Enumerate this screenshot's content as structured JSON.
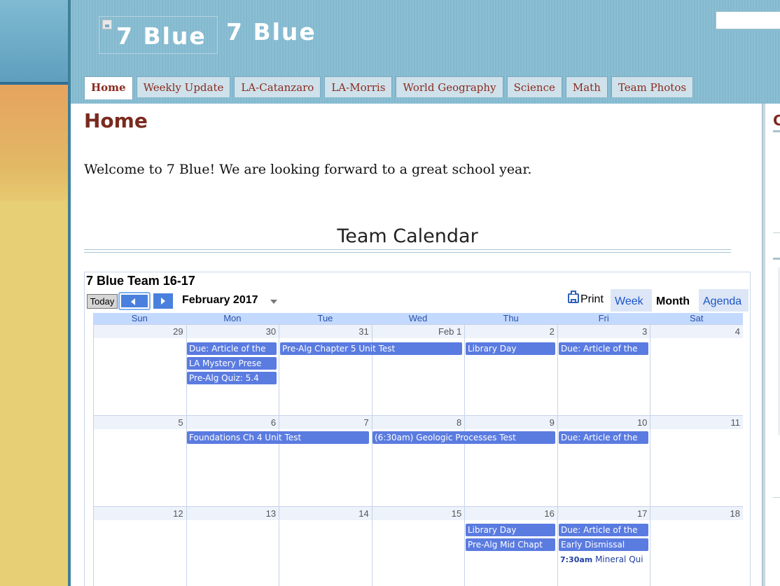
{
  "header": {
    "logo_alt": "7 Blue",
    "site_title": "7 Blue",
    "nav_tabs": [
      {
        "label": "Home",
        "active": true
      },
      {
        "label": "Weekly Update",
        "active": false
      },
      {
        "label": "LA-Catanzaro",
        "active": false
      },
      {
        "label": "LA-Morris",
        "active": false
      },
      {
        "label": "World Geography",
        "active": false
      },
      {
        "label": "Science",
        "active": false
      },
      {
        "label": "Math",
        "active": false
      },
      {
        "label": "Team Photos",
        "active": false
      }
    ]
  },
  "sidebar": {
    "heading_fragment": "C"
  },
  "main": {
    "page_title": "Home",
    "welcome_text": "Welcome to 7 Blue!  We are looking forward to a great school year.",
    "calendar_heading": "Team Calendar"
  },
  "calendar": {
    "name": "7 Blue Team 16-17",
    "today_label": "Today",
    "month_label": "February 2017",
    "print_label": "Print",
    "views": [
      {
        "label": "Week",
        "active": false
      },
      {
        "label": "Month",
        "active": true
      },
      {
        "label": "Agenda",
        "active": false
      }
    ],
    "weekdays": [
      "Sun",
      "Mon",
      "Tue",
      "Wed",
      "Thu",
      "Fri",
      "Sat"
    ],
    "weeks": [
      {
        "days": [
          "29",
          "30",
          "31",
          "Feb 1",
          "2",
          "3",
          "4"
        ]
      },
      {
        "days": [
          "5",
          "6",
          "7",
          "8",
          "9",
          "10",
          "11"
        ]
      },
      {
        "days": [
          "12",
          "13",
          "14",
          "15",
          "16",
          "17",
          "18"
        ]
      }
    ],
    "events": {
      "w1_mon_article": "Due: Article of the",
      "w1_mon_mystery": "LA Mystery Prese",
      "w1_mon_quiz": "Pre-Alg Quiz: 5.4",
      "w1_tue_unit_test": "Pre-Alg Chapter 5 Unit Test",
      "w1_thu_library": "Library Day",
      "w1_fri_article": "Due: Article of the",
      "w2_mon_foundations": "Foundations Ch 4 Unit Test",
      "w2_wed_geologic": "(6:30am) Geologic Processes Test",
      "w2_fri_article": "Due: Article of the",
      "w3_thu_library": "Library Day",
      "w3_thu_prealg": "Pre-Alg Mid Chapt",
      "w3_fri_article": "Due: Article of the",
      "w3_fri_dismissal": "Early Dismissal",
      "w3_fri_mineral_time": "7:30am",
      "w3_fri_mineral_title": "Mineral Qui"
    }
  },
  "colors": {
    "header_blue": "#8cbfd4",
    "title_maroon": "#7a2a1e",
    "event_blue": "#5a7be0",
    "calendar_header_blue": "#c3d9ff"
  }
}
